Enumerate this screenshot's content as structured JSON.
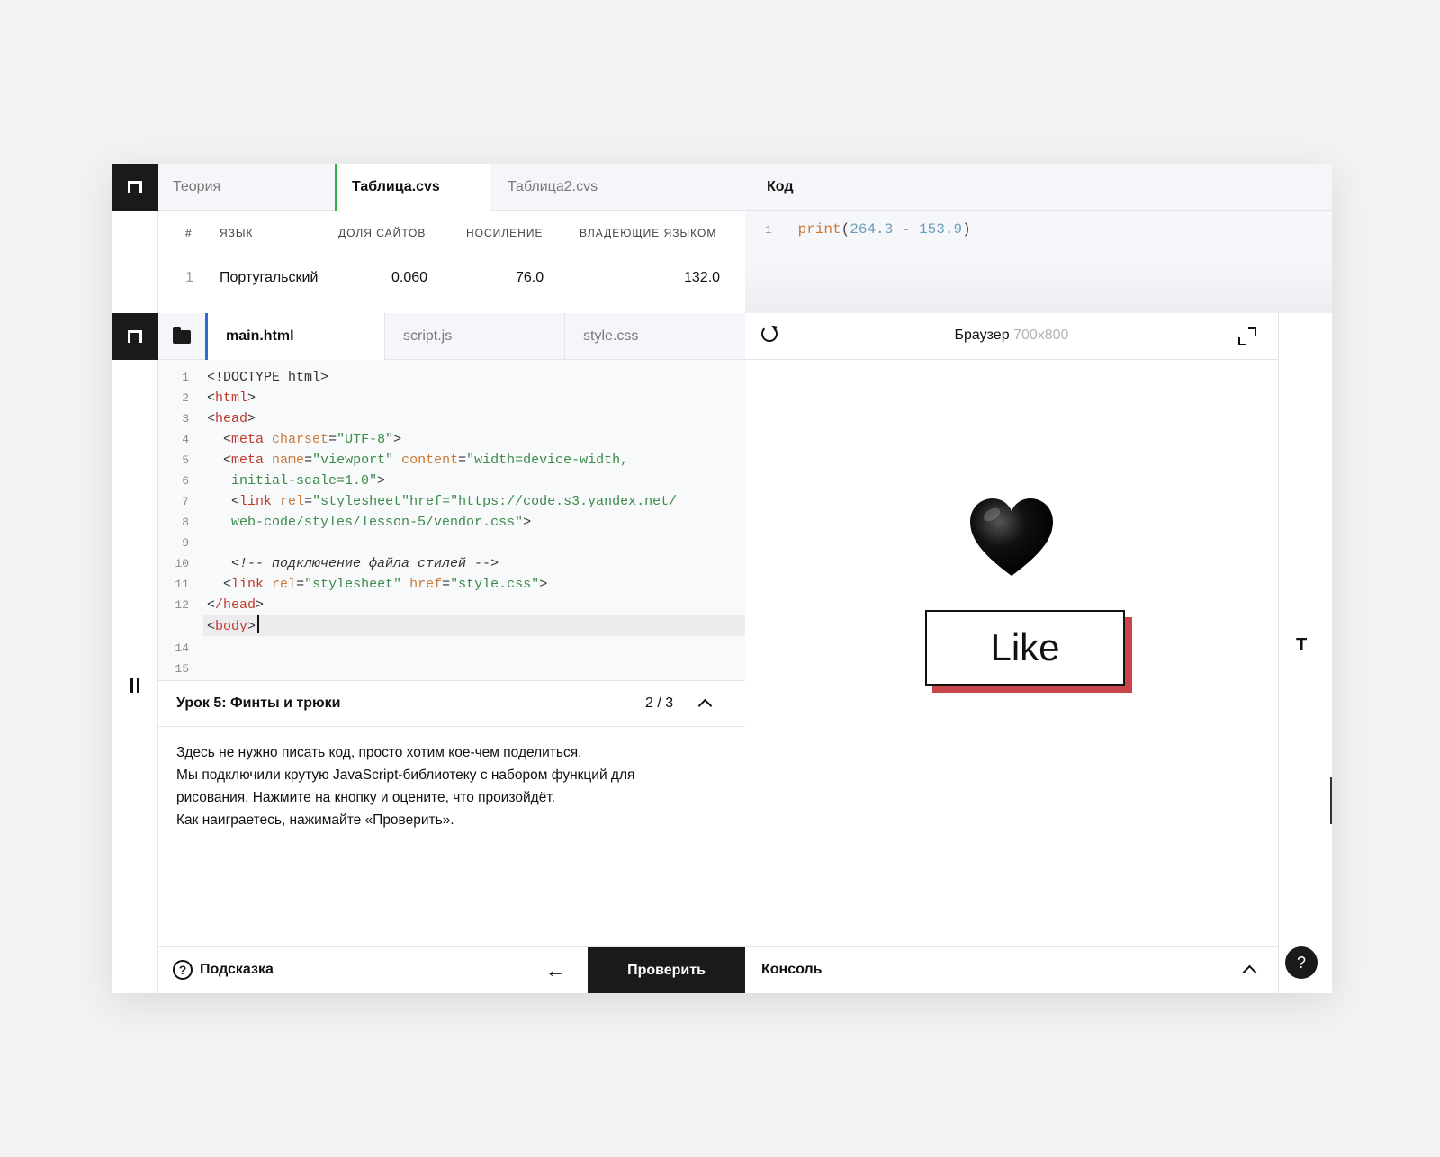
{
  "top_tabs": [
    "Теория",
    "Таблица.cvs",
    "Таблица2.cvs"
  ],
  "table": {
    "headers": [
      "#",
      "ЯЗЫК",
      "ДОЛЯ САЙТОВ",
      "НОСИЛЕНИЕ",
      "ВЛАДЕЮЩИЕ ЯЗЫКОМ"
    ],
    "rows": [
      [
        "1",
        "Португальский",
        "0.060",
        "76.0",
        "132.0"
      ]
    ]
  },
  "code_panel": {
    "title": "Код",
    "line_no": "1",
    "fn": "print",
    "open": "(",
    "a": "264.3",
    "op": " - ",
    "b": "153.9",
    "close": ")"
  },
  "file_tabs": [
    "main.html",
    "script.js",
    "style.css"
  ],
  "editor_line_numbers": [
    "1",
    "2",
    "3",
    "4",
    "5",
    "6",
    "7",
    "8",
    "9",
    "10",
    "11",
    "12",
    "",
    "14",
    "15"
  ],
  "lesson": {
    "title": "Урок 5: Финты и трюки",
    "progress": "2 / 3",
    "text": [
      "Здесь не нужно писать код, просто хотим кое-чем поделиться.",
      "Мы подключили крутую JavaScript-библиотеку с набором функций для",
      "рисования. Нажмите на кнопку и оцените, что произойдёт.",
      "Как наиграетесь, нажимайте «Проверить»."
    ]
  },
  "footer": {
    "hint_label": "Подсказка",
    "hint_icon": "?",
    "back_icon": "←",
    "check_label": "Проверить",
    "console_label": "Консоль",
    "help_icon": "?"
  },
  "browser": {
    "title": "Браузер",
    "size": "700x800",
    "like_label": "Like"
  },
  "right_rail": {
    "t_label": "T"
  },
  "colors": {
    "accent_green": "#27b24a",
    "accent_blue": "#2a6bd8",
    "like_shadow": "#c8464b",
    "dark": "#1a1a1a"
  },
  "icons": [
    "logo-icon",
    "folder-icon",
    "pause-icon",
    "reload-icon",
    "expand-icon",
    "chevron-up-icon",
    "help-icon",
    "heart-icon"
  ]
}
